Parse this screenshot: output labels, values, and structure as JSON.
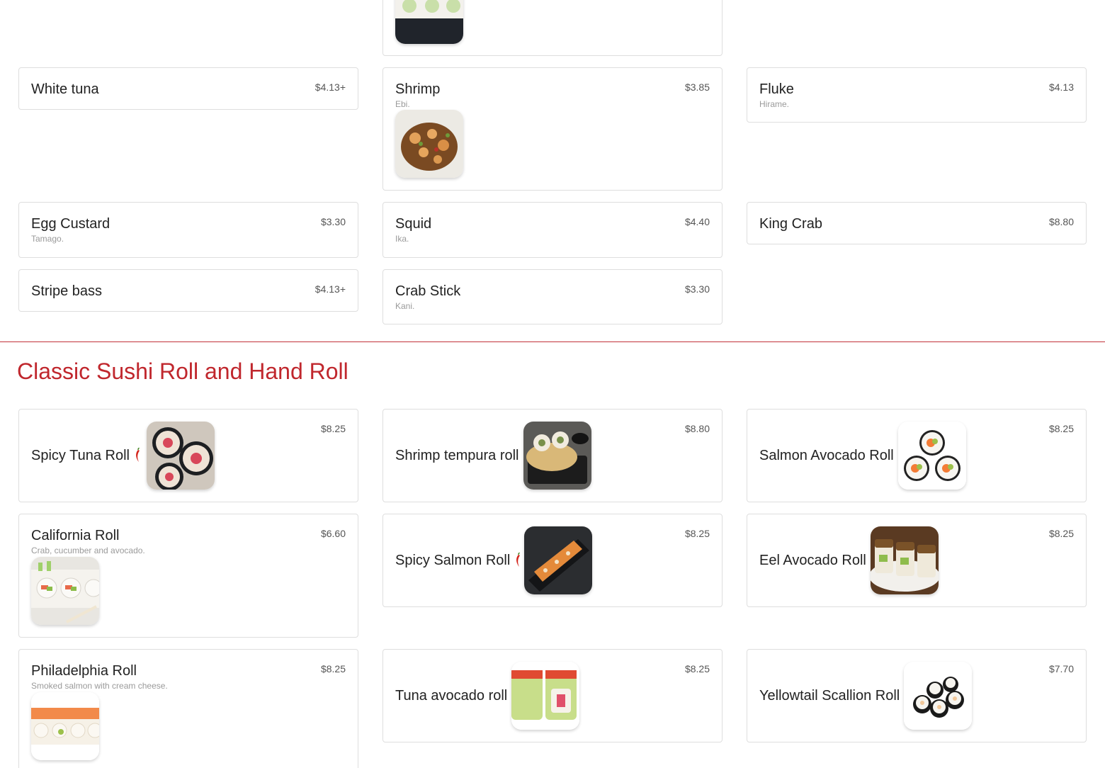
{
  "top_section": {
    "items": [
      {
        "name": "White tuna",
        "price": "$4.13+"
      },
      {
        "name": "Shrimp",
        "description": "Ebi.",
        "price": "$3.85"
      },
      {
        "name": "Fluke",
        "description": "Hirame.",
        "price": "$4.13"
      },
      {
        "name": "Egg Custard",
        "description": "Tamago.",
        "price": "$3.30"
      },
      {
        "name": "Squid",
        "description": "Ika.",
        "price": "$4.40"
      },
      {
        "name": "King Crab",
        "price": "$8.80"
      },
      {
        "name": "Stripe bass",
        "price": "$4.13+"
      },
      {
        "name": "Crab Stick",
        "description": "Kani.",
        "price": "$3.30"
      }
    ]
  },
  "roll_section": {
    "title": "Classic Sushi Roll and Hand Roll",
    "items": [
      {
        "name": "Spicy Tuna Roll",
        "price": "$8.25",
        "spicy": true
      },
      {
        "name": "Shrimp tempura roll",
        "price": "$8.80"
      },
      {
        "name": "Salmon Avocado Roll",
        "price": "$8.25"
      },
      {
        "name": "California Roll",
        "description": "Crab, cucumber and avocado.",
        "price": "$6.60"
      },
      {
        "name": "Spicy Salmon Roll",
        "price": "$8.25",
        "spicy": true
      },
      {
        "name": "Eel Avocado Roll",
        "price": "$8.25"
      },
      {
        "name": "Philadelphia Roll",
        "description": "Smoked salmon with cream cheese.",
        "price": "$8.25"
      },
      {
        "name": "Tuna avocado roll",
        "price": "$8.25"
      },
      {
        "name": "Yellowtail Scallion Roll",
        "price": "$7.70"
      }
    ]
  },
  "icons": {
    "spicy": "chili-pepper-icon"
  },
  "colors": {
    "accent": "#c0272d",
    "divider": "#c3323a",
    "card_border": "#dedede",
    "description": "#9a9a9a"
  }
}
